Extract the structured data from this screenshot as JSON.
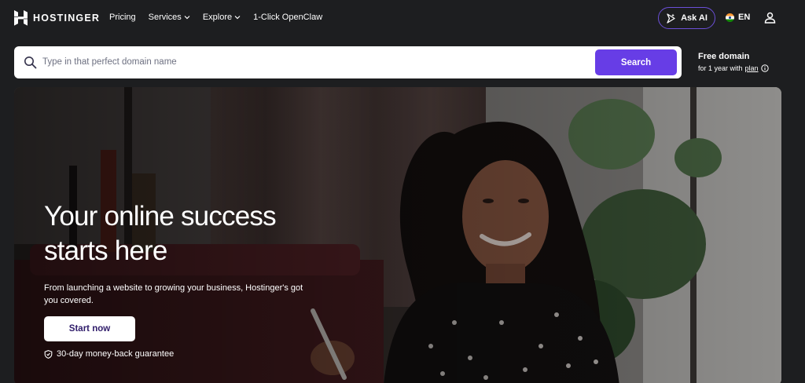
{
  "header": {
    "brand": "HOSTINGER",
    "nav": [
      {
        "label": "Pricing",
        "dropdown": false
      },
      {
        "label": "Services",
        "dropdown": true
      },
      {
        "label": "Explore",
        "dropdown": true
      },
      {
        "label": "1-Click OpenClaw",
        "dropdown": false
      }
    ],
    "ask_ai": "Ask AI",
    "language": "EN"
  },
  "search": {
    "placeholder": "Type in that perfect domain name",
    "value": "",
    "button": "Search"
  },
  "free_domain": {
    "title": "Free domain",
    "sub_prefix": "for 1 year with",
    "sub_link": "plan"
  },
  "hero": {
    "title": "Your online success\nstarts here",
    "subtitle": "From launching a website to growing your business, Hostinger's got you covered.",
    "cta": "Start now",
    "guarantee": "30-day money-back guarantee"
  },
  "colors": {
    "background": "#1d1e20",
    "accent": "#673de6",
    "ask_ai_border": "#6b4fd8",
    "button_text": "#2f1c6a"
  }
}
